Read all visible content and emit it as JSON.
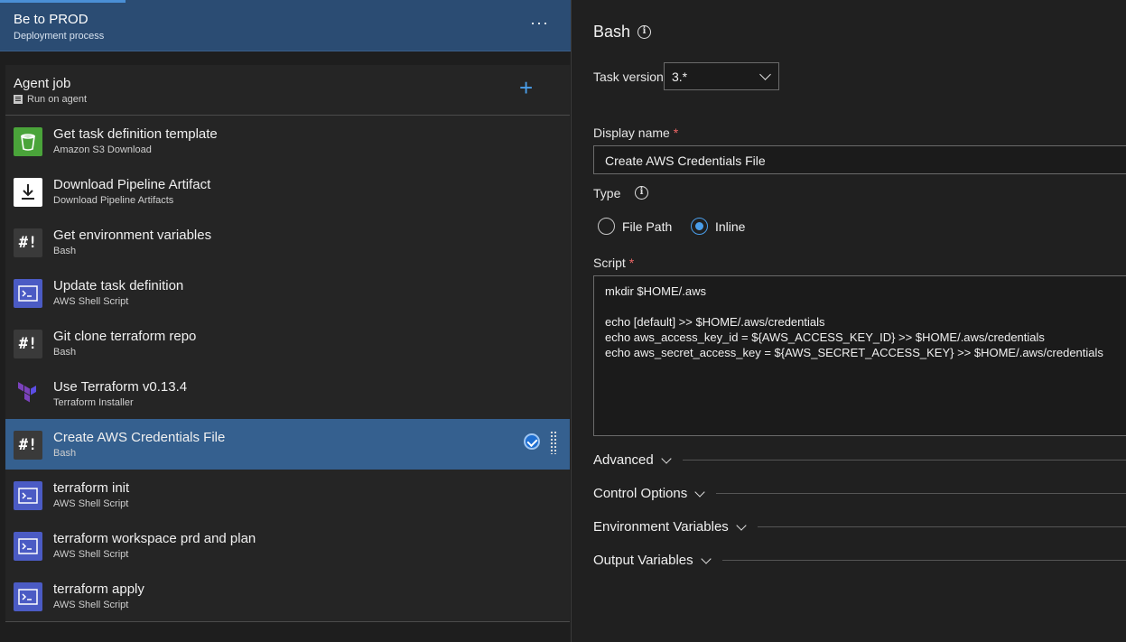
{
  "header": {
    "title": "Be to PROD",
    "subtitle": "Deployment process",
    "more_label": "···"
  },
  "agent_job": {
    "title": "Agent job",
    "subtitle": "Run on agent",
    "add_label": "+"
  },
  "tasks": [
    {
      "name": "Get task definition template",
      "type": "Amazon S3 Download",
      "icon": "s3-bucket-icon"
    },
    {
      "name": "Download Pipeline Artifact",
      "type": "Download Pipeline Artifacts",
      "icon": "download-icon"
    },
    {
      "name": "Get environment variables",
      "type": "Bash",
      "icon": "bash-icon"
    },
    {
      "name": "Update task definition",
      "type": "AWS Shell Script",
      "icon": "terminal-icon"
    },
    {
      "name": "Git clone terraform repo",
      "type": "Bash",
      "icon": "bash-icon"
    },
    {
      "name": "Use Terraform v0.13.4",
      "type": "Terraform Installer",
      "icon": "terraform-icon"
    },
    {
      "name": "Create AWS Credentials File",
      "type": "Bash",
      "icon": "bash-icon",
      "selected": true
    },
    {
      "name": "terraform init",
      "type": "AWS Shell Script",
      "icon": "terminal-icon"
    },
    {
      "name": "terraform workspace prd and plan",
      "type": "AWS Shell Script",
      "icon": "terminal-icon"
    },
    {
      "name": "terraform apply",
      "type": "AWS Shell Script",
      "icon": "terminal-icon"
    }
  ],
  "bash_glyph": "#!",
  "details": {
    "title": "Bash",
    "task_version_label": "Task version",
    "task_version_value": "3.*",
    "display_name_label": "Display name",
    "display_name_value": "Create AWS Credentials File",
    "type_label": "Type",
    "type_options": [
      {
        "label": "File Path",
        "selected": false
      },
      {
        "label": "Inline",
        "selected": true
      }
    ],
    "script_label": "Script",
    "script_lines": [
      "mkdir $HOME/.aws",
      "",
      "echo [default] >> $HOME/.aws/credentials",
      "echo aws_access_key_id = ${AWS_ACCESS_KEY_ID} >> $HOME/.aws/credentials",
      "echo aws_secret_access_key = ${AWS_SECRET_ACCESS_KEY} >> $HOME/.aws/credentials"
    ],
    "required_marker": "*",
    "sections": [
      "Advanced",
      "Control Options",
      "Environment Variables",
      "Output Variables"
    ]
  },
  "colors": {
    "accent": "#4a9eea",
    "header_bg": "#2b4c73",
    "selected_bg": "#35608f",
    "required": "#e66666"
  }
}
